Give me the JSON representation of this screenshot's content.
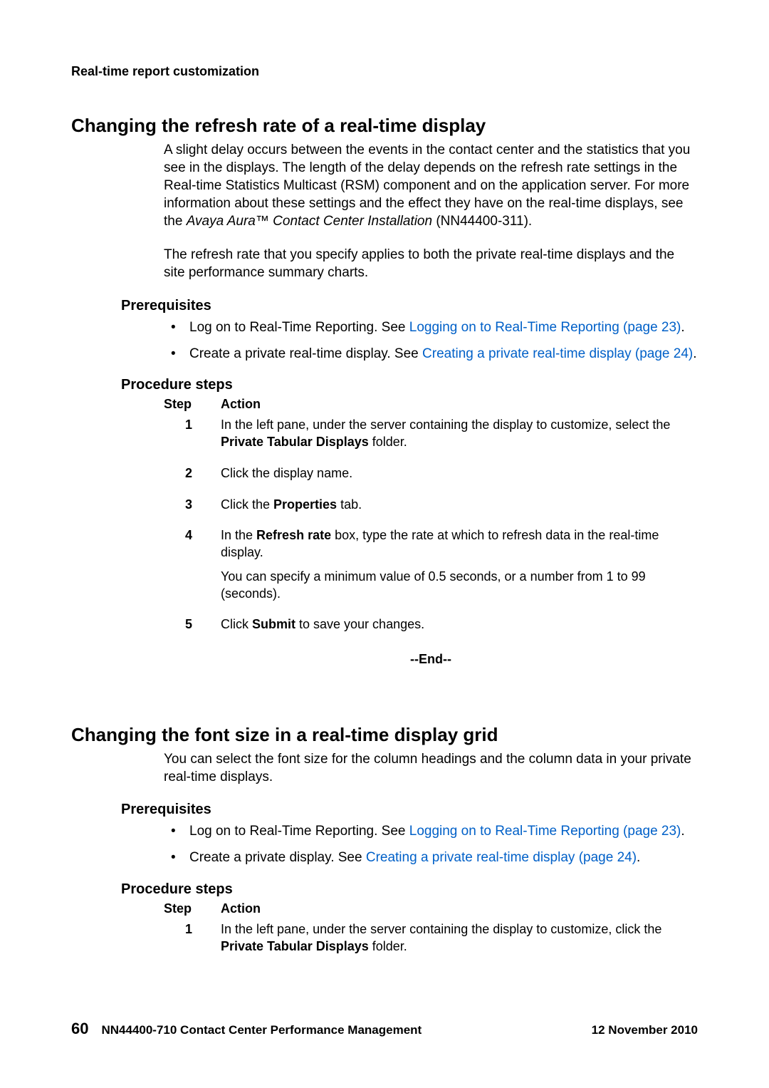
{
  "header": {
    "running": "Real-time report customization"
  },
  "section1": {
    "title": "Changing the refresh rate of a real-time display",
    "para1a": "A slight delay occurs between the events in the contact center and the statistics that you see in the displays. The length of the delay depends on the refresh rate settings in the Real-time Statistics Multicast (RSM) component and on the application server. For more information about these settings and the effect they have on the real-time displays, see the ",
    "para1_italic": "Avaya Aura™ Contact Center Installation",
    "para1b": " (NN44400-311).",
    "para2": "The refresh rate that you specify applies to both the private real-time displays and the site performance summary charts.",
    "prereq_heading": "Prerequisites",
    "prereq": [
      {
        "text": "Log on to Real-Time Reporting. See ",
        "link": "Logging on to Real-Time Reporting (page 23)",
        "after": "."
      },
      {
        "text": "Create a private real-time display. See ",
        "link": "Creating a private real-time display (page 24)",
        "after": "."
      }
    ],
    "steps_heading": "Procedure steps",
    "table_headers": {
      "step": "Step",
      "action": "Action"
    },
    "steps": [
      {
        "n": "1",
        "action_pre": "In the left pane, under the server containing the display to customize, select the ",
        "action_bold": "Private Tabular Displays",
        "action_post": " folder."
      },
      {
        "n": "2",
        "action_pre": "Click the display name.",
        "action_bold": "",
        "action_post": ""
      },
      {
        "n": "3",
        "action_pre": "Click the ",
        "action_bold": "Properties",
        "action_post": " tab."
      },
      {
        "n": "4",
        "action_pre": "In the ",
        "action_bold": "Refresh rate",
        "action_post": " box, type the rate at which to refresh data in the real-time display.",
        "extra": "You can specify a minimum value of 0.5 seconds, or a number from 1 to 99 (seconds)."
      },
      {
        "n": "5",
        "action_pre": "Click ",
        "action_bold": "Submit",
        "action_post": " to save your changes."
      }
    ],
    "end": "--End--"
  },
  "section2": {
    "title": "Changing the font size in a real-time display grid",
    "para1": "You can select the font size for the column headings and the column data in your private real-time displays.",
    "prereq_heading": "Prerequisites",
    "prereq": [
      {
        "text": "Log on to Real-Time Reporting. See ",
        "link": "Logging on to Real-Time Reporting (page 23)",
        "after": "."
      },
      {
        "text": "Create a private display. See ",
        "link": "Creating a private real-time display (page 24)",
        "after": "."
      }
    ],
    "steps_heading": "Procedure steps",
    "table_headers": {
      "step": "Step",
      "action": "Action"
    },
    "steps": [
      {
        "n": "1",
        "action_pre": "In the left pane, under the server containing the display to customize, click the ",
        "action_bold": "Private Tabular Displays",
        "action_post": " folder."
      }
    ]
  },
  "footer": {
    "page": "60",
    "doc": "NN44400-710 Contact Center Performance Management",
    "date": "12 November 2010"
  }
}
